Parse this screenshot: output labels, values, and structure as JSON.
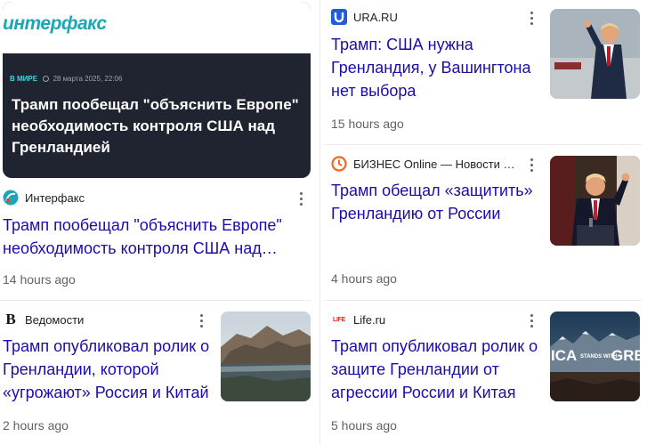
{
  "left": {
    "hero": {
      "logo": "интерфакс",
      "category": "В МИРЕ",
      "date": "28 марта 2025, 22:06",
      "headline": "Трамп пообещал \"объяснить Европе\" необходимость контроля США над Гренландией"
    },
    "articles": [
      {
        "source": "Интерфакс",
        "favicon": "interfax-icon",
        "title": "Трамп пообещал \"объяснить Европе\" необходимость контроля США над…",
        "time": "14 hours ago"
      },
      {
        "source": "Ведомости",
        "favicon": "vedomosti-icon",
        "title": "Трамп опубликовал ролик о Гренландии, которой «угрожают» Россия и Китай",
        "time": "2 hours ago",
        "thumbnail": "greenland-landscape-image"
      }
    ]
  },
  "right": {
    "articles": [
      {
        "source": "URA.RU",
        "favicon": "ura-icon",
        "title": "Трамп: США нужна Гренландия, у Вашингтона нет выбора",
        "time": "15 hours ago",
        "thumbnail": "trump-walking-image"
      },
      {
        "source": "БИЗНЕС Online — Новости …",
        "favicon": "business-online-icon",
        "title": "Трамп обещал «защитить» Гренландию от России",
        "time": "4 hours ago",
        "thumbnail": "trump-podium-image"
      },
      {
        "source": "Life.ru",
        "favicon": "life-icon",
        "title": "Трамп опубликовал ролик о защите Гренландии от агрессии России и Китая",
        "time": "5 hours ago",
        "thumbnail": "stands-with-greenland-image",
        "thumbnail_text": [
          "ICA",
          "STANDS WITH",
          "GREEN"
        ]
      }
    ]
  },
  "colors": {
    "title_link": "#1a0dab",
    "time": "#5f6368",
    "hero_bg": "#1f2430",
    "interfax_teal": "#1aa6b7",
    "ura_blue": "#1e5cd8",
    "business_orange": "#f26522",
    "life_red": "#e2261c"
  }
}
